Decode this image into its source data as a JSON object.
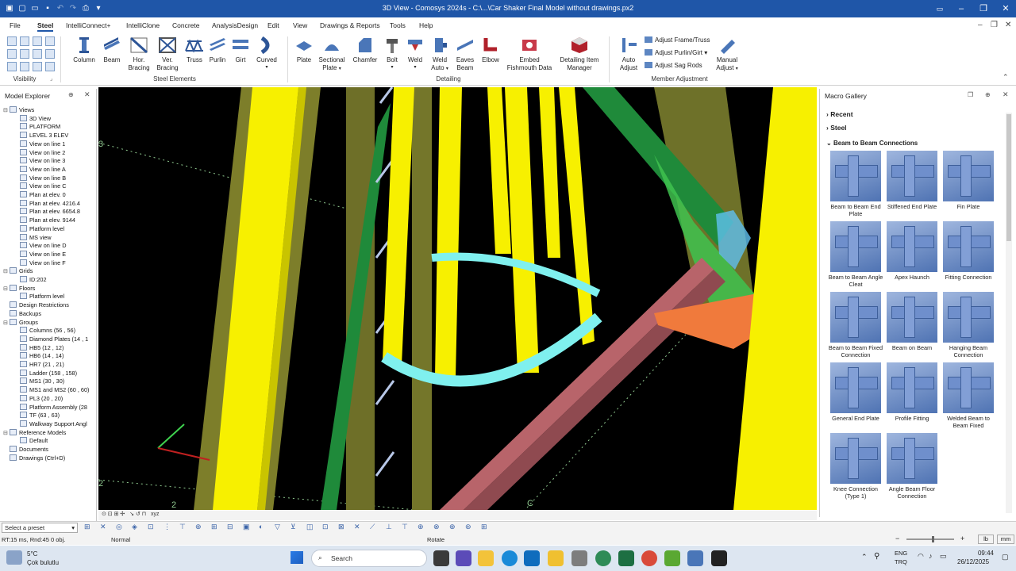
{
  "window": {
    "title": "3D View - Comosys 2024s - C:\\...\\Car Shaker Final Model without drawings.px2"
  },
  "menu": {
    "tabs": [
      "File",
      "Steel",
      "IntelliConnect+",
      "IntelliClone",
      "Concrete",
      "AnalysisDesign",
      "Edit",
      "View",
      "Drawings & Reports",
      "Tools",
      "Help"
    ],
    "active": "Steel"
  },
  "ribbon": {
    "visibility_label": "Visibility",
    "steel_elements": {
      "label": "Steel Elements",
      "buttons": [
        "Column",
        "Beam",
        "Hor. Bracing",
        "Ver. Bracing",
        "Truss",
        "Purlin",
        "Girt",
        "Curved"
      ]
    },
    "detailing": {
      "label": "Detailing",
      "buttons": [
        "Plate",
        "Sectional Plate",
        "Chamfer",
        "Bolt",
        "Weld",
        "Weld Auto",
        "Eaves Beam",
        "Elbow",
        "Embed Fishmouth Data",
        "Detailing Item Manager"
      ]
    },
    "member_adjustment": {
      "label": "Member Adjustment",
      "auto_adjust": "Auto Adjust",
      "adjust_frame": "Adjust Frame/Truss",
      "adjust_purlin": "Adjust Purlin/Girt",
      "adjust_sag": "Adjust Sag Rods",
      "manual_adjust": "Manual Adjust"
    }
  },
  "model_explorer": {
    "title": "Model Explorer",
    "tree": [
      {
        "label": "Views",
        "level": 0,
        "toggle": "-"
      },
      {
        "label": "3D View",
        "level": 1
      },
      {
        "label": "PLATFORM",
        "level": 1
      },
      {
        "label": "LEVEL 3 ELEV",
        "level": 1
      },
      {
        "label": "View on line 1",
        "level": 1
      },
      {
        "label": "View on line 2",
        "level": 1
      },
      {
        "label": "View on line 3",
        "level": 1
      },
      {
        "label": "View on line A",
        "level": 1
      },
      {
        "label": "View on line B",
        "level": 1
      },
      {
        "label": "View on line C",
        "level": 1
      },
      {
        "label": "Plan at elev. 0",
        "level": 1
      },
      {
        "label": "Plan at elev. 4216.4",
        "level": 1
      },
      {
        "label": "Plan at elev. 6654.8",
        "level": 1
      },
      {
        "label": "Plan at elev. 9144",
        "level": 1
      },
      {
        "label": "Platform level",
        "level": 1
      },
      {
        "label": "MS view",
        "level": 1
      },
      {
        "label": "View on line D",
        "level": 1
      },
      {
        "label": "View on line E",
        "level": 1
      },
      {
        "label": "View on line F",
        "level": 1
      },
      {
        "label": "Grids",
        "level": 0,
        "toggle": "-"
      },
      {
        "label": "ID:202",
        "level": 1
      },
      {
        "label": "Floors",
        "level": 0,
        "toggle": "-"
      },
      {
        "label": "Platform level",
        "level": 1
      },
      {
        "label": "Design Restrictions",
        "level": 0
      },
      {
        "label": "Backups",
        "level": 0
      },
      {
        "label": "Groups",
        "level": 0,
        "toggle": "-"
      },
      {
        "label": "Columns (56 , 56)",
        "level": 1
      },
      {
        "label": "Diamond Plates (14 , 1",
        "level": 1
      },
      {
        "label": "HB5 (12 , 12)",
        "level": 1
      },
      {
        "label": "HB6 (14 , 14)",
        "level": 1
      },
      {
        "label": "HR7 (21 , 21)",
        "level": 1
      },
      {
        "label": "Ladder (158 , 158)",
        "level": 1
      },
      {
        "label": "MS1 (30 , 30)",
        "level": 1
      },
      {
        "label": "MS1 and MS2 (60 , 60)",
        "level": 1
      },
      {
        "label": "PL3 (20 , 20)",
        "level": 1
      },
      {
        "label": "Platform Assembly (28",
        "level": 1
      },
      {
        "label": "TF (63 , 63)",
        "level": 1
      },
      {
        "label": "Walkway Support Angl",
        "level": 1
      },
      {
        "label": "Reference Models",
        "level": 0,
        "toggle": "-"
      },
      {
        "label": "Default",
        "level": 1
      },
      {
        "label": "Documents",
        "level": 0
      },
      {
        "label": "Drawings (Ctrl+D)",
        "level": 0
      }
    ]
  },
  "macro_gallery": {
    "title": "Macro Gallery",
    "sections": [
      "Recent",
      "Steel",
      "Beam to Beam Connections"
    ],
    "items": [
      "Beam to Beam End Plate",
      "Stiffened End Plate",
      "Fin Plate",
      "Beam to Beam Angle Cleat",
      "Apex Haunch",
      "Fitting Connection",
      "Beam to Beam Fixed Connection",
      "Beam on Beam",
      "Hanging Beam Connection",
      "General End Plate",
      "Profile Fitting",
      "Welded Beam to Beam Fixed",
      "Knee Connection (Type 1)",
      "Angle Beam Floor Connection"
    ]
  },
  "viewport": {
    "grid_labels": [
      "3",
      "2",
      "2",
      "C"
    ],
    "axis_label": "xyz"
  },
  "bottom": {
    "preset": "Select a preset",
    "status_left": "RT:15 ms, Rnd:45  0 obj.",
    "status_mode": "Normal",
    "status_action": "Rotate",
    "unit1": "lb",
    "unit2": "mm"
  },
  "taskbar": {
    "weather_temp": "5°C",
    "weather_desc": "Çok bulutlu",
    "search": "Search",
    "lang1": "ENG",
    "lang2": "TRQ",
    "time": "09:44",
    "date": "26/12/2025"
  },
  "colors": {
    "titlebar": "#1f56a8",
    "viewport_bg": "#000000",
    "yellow_member": "#f7f000",
    "green_member": "#1f8a3a",
    "cyan_ring": "#7ff0ee",
    "pink_beam": "#b8646a",
    "orange_plate": "#f07a3c"
  }
}
